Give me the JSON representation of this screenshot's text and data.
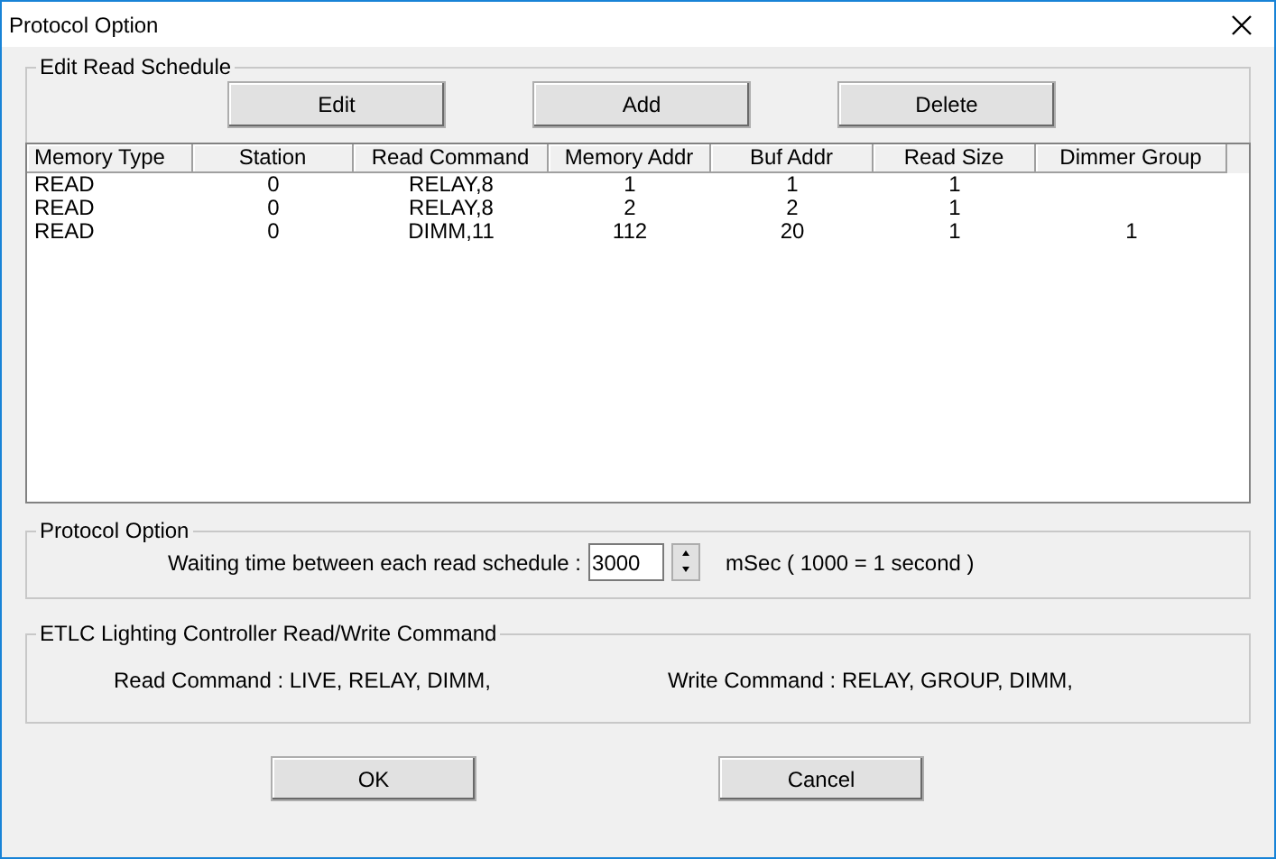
{
  "window": {
    "title": "Protocol Option"
  },
  "schedule": {
    "title": "Edit Read Schedule",
    "buttons": [
      "Edit",
      "Add",
      "Delete"
    ],
    "columns": [
      "Memory Type",
      "Station",
      "Read Command",
      "Memory Addr",
      "Buf Addr",
      "Read Size",
      "Dimmer Group"
    ],
    "rows": [
      [
        "READ",
        "0",
        "RELAY,8",
        "1",
        "1",
        "1",
        ""
      ],
      [
        "READ",
        "0",
        "RELAY,8",
        "2",
        "2",
        "1",
        ""
      ],
      [
        "READ",
        "0",
        "DIMM,11",
        "112",
        "20",
        "1",
        "1"
      ]
    ]
  },
  "protocol": {
    "title": "Protocol Option",
    "label": "Waiting time between each read schedule :",
    "value": "3000",
    "unit": "mSec ( 1000 = 1 second )"
  },
  "commands": {
    "title": "ETLC Lighting Controller Read/Write Command",
    "read": "Read Command : LIVE, RELAY, DIMM,",
    "write": "Write Command : RELAY, GROUP, DIMM,"
  },
  "buttons": [
    "OK",
    "Cancel"
  ]
}
